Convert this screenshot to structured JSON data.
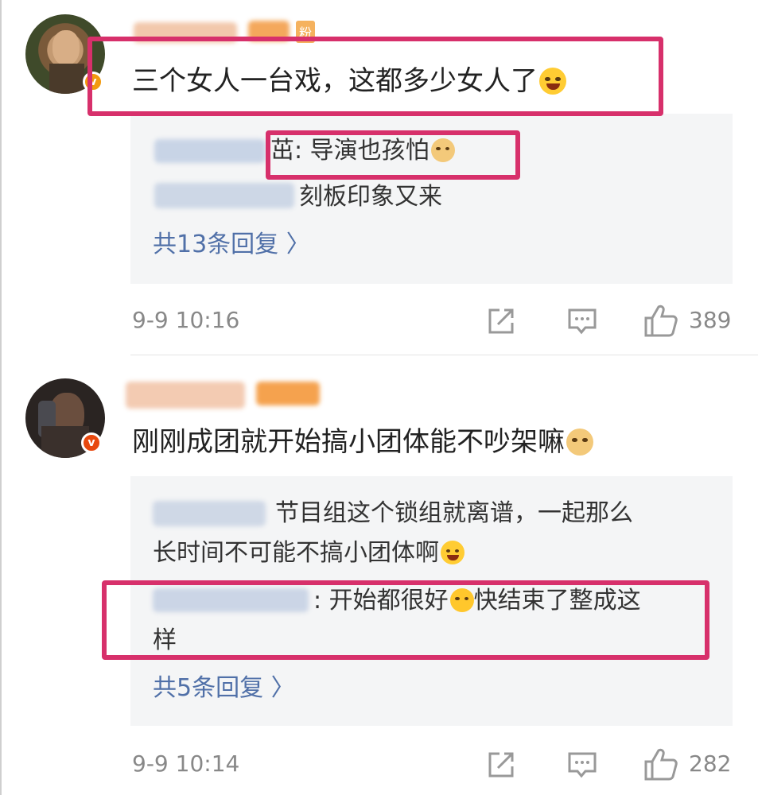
{
  "comments": [
    {
      "text": "三个女人一台戏，这都多少女人了",
      "fan_badge": "粉",
      "replies": [
        {
          "text": "茁: 导演也孩怕"
        },
        {
          "text": "刻板印象又来"
        }
      ],
      "more_replies": "共13条回复 〉",
      "time": "9-9 10:16",
      "likes": "389"
    },
    {
      "text": "刚刚成团就开始搞小团体能不吵架嘛",
      "replies": [
        {
          "line1": "节目组这个锁组就离谱，一起那么",
          "line2": "长时间不可能不搞小团体啊"
        },
        {
          "line1": ": 开始都很好",
          "line1b": "快结束了整成这",
          "line2": "样"
        }
      ],
      "more_replies": "共5条回复 〉",
      "time": "9-9 10:14",
      "likes": "282"
    }
  ],
  "icons": {
    "share": "share-icon",
    "comment": "comment-icon",
    "like": "thumbs-up-icon",
    "verified": "verified-badge-icon",
    "chevron": "chevron-right-icon"
  },
  "colors": {
    "highlight": "#d7306b",
    "link": "#5070a8",
    "reply_bg": "#f4f5f6"
  }
}
